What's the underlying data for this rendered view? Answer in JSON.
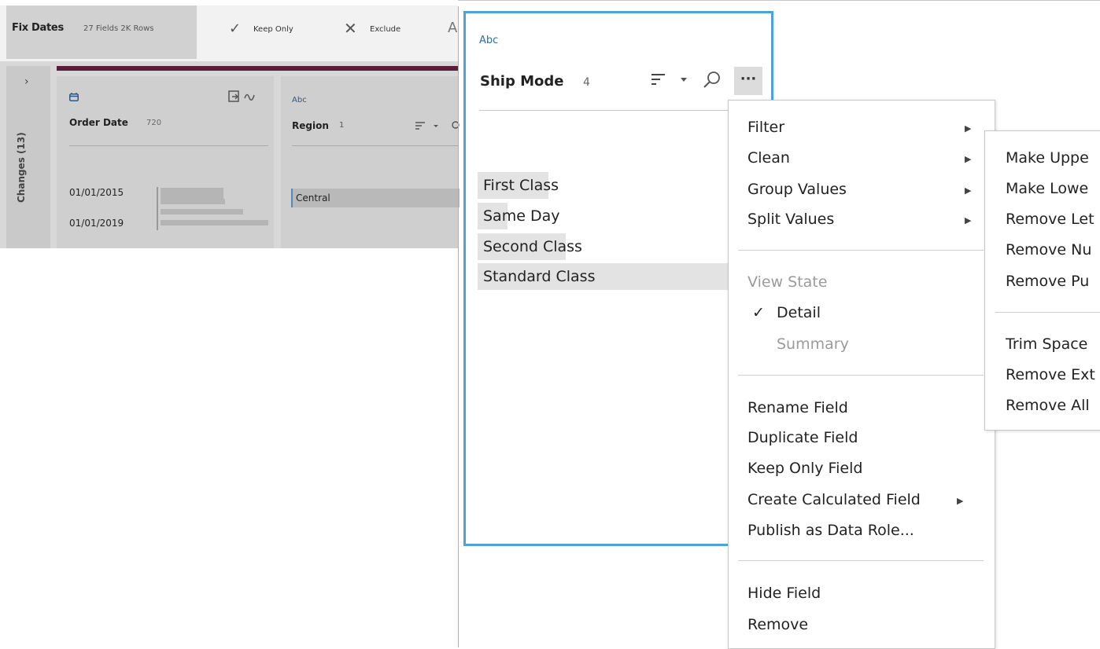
{
  "step": {
    "name": "Fix Dates",
    "meta": "27 Fields  2K Rows"
  },
  "toolbar": {
    "keep_only_icon": "✓",
    "keep_only_label": "Keep Only",
    "exclude_icon": "✕",
    "exclude_label": "Exclude",
    "overflow_glyph": "A"
  },
  "changes": {
    "chevron": "›",
    "label": "Changes (13)"
  },
  "cards": {
    "order_date": {
      "type_icon": "calendar-icon",
      "name": "Order Date",
      "count": "720",
      "values": [
        "01/01/2015",
        "01/01/2019"
      ]
    },
    "region": {
      "type": "Abc",
      "name": "Region",
      "count": "1",
      "values": [
        "Central"
      ]
    }
  },
  "ship_mode": {
    "type": "Abc",
    "name": "Ship Mode",
    "count": "4",
    "more": "···",
    "values": [
      {
        "label": "First Class"
      },
      {
        "label": "Same Day"
      },
      {
        "label": "Second Class"
      },
      {
        "label": "Standard Class"
      }
    ]
  },
  "menu": {
    "filter": "Filter",
    "clean": "Clean",
    "group_values": "Group Values",
    "split_values": "Split Values",
    "view_state": "View State",
    "detail": "Detail",
    "detail_check": "✓",
    "summary": "Summary",
    "rename_field": "Rename Field",
    "duplicate_field": "Duplicate Field",
    "keep_only_field": "Keep Only Field",
    "create_calculated_field": "Create Calculated Field",
    "publish_as_data_role": "Publish as Data Role...",
    "hide_field": "Hide Field",
    "remove": "Remove"
  },
  "submenu": {
    "items": [
      "Make Uppe",
      "Make Lowe",
      "Remove Let",
      "Remove Nu",
      "Remove Pu",
      "Trim Space",
      "Remove Ext",
      "Remove All"
    ]
  }
}
